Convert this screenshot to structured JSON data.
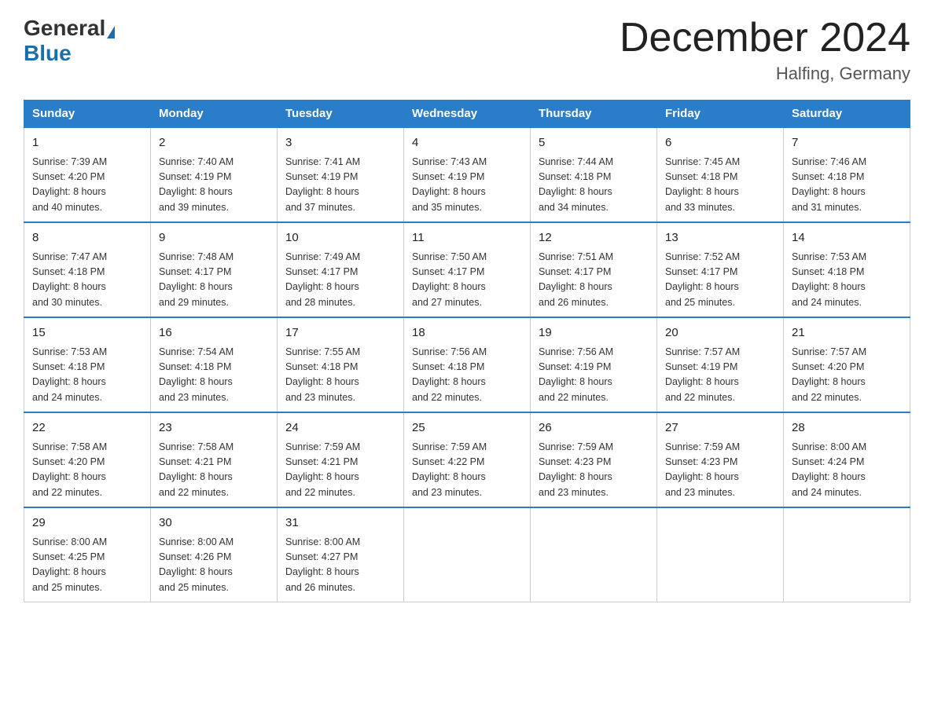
{
  "logo": {
    "general": "General",
    "blue": "Blue"
  },
  "title": "December 2024",
  "subtitle": "Halfing, Germany",
  "days_of_week": [
    "Sunday",
    "Monday",
    "Tuesday",
    "Wednesday",
    "Thursday",
    "Friday",
    "Saturday"
  ],
  "weeks": [
    [
      {
        "day": "1",
        "sunrise": "7:39 AM",
        "sunset": "4:20 PM",
        "daylight": "8 hours and 40 minutes."
      },
      {
        "day": "2",
        "sunrise": "7:40 AM",
        "sunset": "4:19 PM",
        "daylight": "8 hours and 39 minutes."
      },
      {
        "day": "3",
        "sunrise": "7:41 AM",
        "sunset": "4:19 PM",
        "daylight": "8 hours and 37 minutes."
      },
      {
        "day": "4",
        "sunrise": "7:43 AM",
        "sunset": "4:19 PM",
        "daylight": "8 hours and 35 minutes."
      },
      {
        "day": "5",
        "sunrise": "7:44 AM",
        "sunset": "4:18 PM",
        "daylight": "8 hours and 34 minutes."
      },
      {
        "day": "6",
        "sunrise": "7:45 AM",
        "sunset": "4:18 PM",
        "daylight": "8 hours and 33 minutes."
      },
      {
        "day": "7",
        "sunrise": "7:46 AM",
        "sunset": "4:18 PM",
        "daylight": "8 hours and 31 minutes."
      }
    ],
    [
      {
        "day": "8",
        "sunrise": "7:47 AM",
        "sunset": "4:18 PM",
        "daylight": "8 hours and 30 minutes."
      },
      {
        "day": "9",
        "sunrise": "7:48 AM",
        "sunset": "4:17 PM",
        "daylight": "8 hours and 29 minutes."
      },
      {
        "day": "10",
        "sunrise": "7:49 AM",
        "sunset": "4:17 PM",
        "daylight": "8 hours and 28 minutes."
      },
      {
        "day": "11",
        "sunrise": "7:50 AM",
        "sunset": "4:17 PM",
        "daylight": "8 hours and 27 minutes."
      },
      {
        "day": "12",
        "sunrise": "7:51 AM",
        "sunset": "4:17 PM",
        "daylight": "8 hours and 26 minutes."
      },
      {
        "day": "13",
        "sunrise": "7:52 AM",
        "sunset": "4:17 PM",
        "daylight": "8 hours and 25 minutes."
      },
      {
        "day": "14",
        "sunrise": "7:53 AM",
        "sunset": "4:18 PM",
        "daylight": "8 hours and 24 minutes."
      }
    ],
    [
      {
        "day": "15",
        "sunrise": "7:53 AM",
        "sunset": "4:18 PM",
        "daylight": "8 hours and 24 minutes."
      },
      {
        "day": "16",
        "sunrise": "7:54 AM",
        "sunset": "4:18 PM",
        "daylight": "8 hours and 23 minutes."
      },
      {
        "day": "17",
        "sunrise": "7:55 AM",
        "sunset": "4:18 PM",
        "daylight": "8 hours and 23 minutes."
      },
      {
        "day": "18",
        "sunrise": "7:56 AM",
        "sunset": "4:18 PM",
        "daylight": "8 hours and 22 minutes."
      },
      {
        "day": "19",
        "sunrise": "7:56 AM",
        "sunset": "4:19 PM",
        "daylight": "8 hours and 22 minutes."
      },
      {
        "day": "20",
        "sunrise": "7:57 AM",
        "sunset": "4:19 PM",
        "daylight": "8 hours and 22 minutes."
      },
      {
        "day": "21",
        "sunrise": "7:57 AM",
        "sunset": "4:20 PM",
        "daylight": "8 hours and 22 minutes."
      }
    ],
    [
      {
        "day": "22",
        "sunrise": "7:58 AM",
        "sunset": "4:20 PM",
        "daylight": "8 hours and 22 minutes."
      },
      {
        "day": "23",
        "sunrise": "7:58 AM",
        "sunset": "4:21 PM",
        "daylight": "8 hours and 22 minutes."
      },
      {
        "day": "24",
        "sunrise": "7:59 AM",
        "sunset": "4:21 PM",
        "daylight": "8 hours and 22 minutes."
      },
      {
        "day": "25",
        "sunrise": "7:59 AM",
        "sunset": "4:22 PM",
        "daylight": "8 hours and 23 minutes."
      },
      {
        "day": "26",
        "sunrise": "7:59 AM",
        "sunset": "4:23 PM",
        "daylight": "8 hours and 23 minutes."
      },
      {
        "day": "27",
        "sunrise": "7:59 AM",
        "sunset": "4:23 PM",
        "daylight": "8 hours and 23 minutes."
      },
      {
        "day": "28",
        "sunrise": "8:00 AM",
        "sunset": "4:24 PM",
        "daylight": "8 hours and 24 minutes."
      }
    ],
    [
      {
        "day": "29",
        "sunrise": "8:00 AM",
        "sunset": "4:25 PM",
        "daylight": "8 hours and 25 minutes."
      },
      {
        "day": "30",
        "sunrise": "8:00 AM",
        "sunset": "4:26 PM",
        "daylight": "8 hours and 25 minutes."
      },
      {
        "day": "31",
        "sunrise": "8:00 AM",
        "sunset": "4:27 PM",
        "daylight": "8 hours and 26 minutes."
      },
      null,
      null,
      null,
      null
    ]
  ],
  "labels": {
    "sunrise": "Sunrise:",
    "sunset": "Sunset:",
    "daylight": "Daylight:"
  }
}
